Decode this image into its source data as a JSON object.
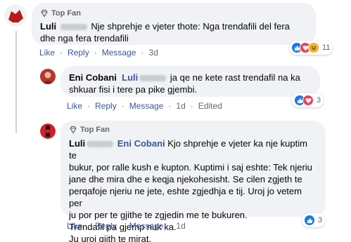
{
  "comments": [
    {
      "badge": "Top Fan",
      "author": "Luli",
      "author_hidden": "H…i",
      "text": "Nje shprehje e vjeter thote: Nga trendafili del fera dhe nga fera trendafili",
      "actions": {
        "like": "Like",
        "reply": "Reply",
        "message": "Message",
        "time": "3d"
      },
      "reactions": {
        "count": "11",
        "types": [
          "like-icon",
          "love-icon",
          "haha-icon"
        ]
      }
    },
    {
      "author": "Eni Cobani",
      "mention": "Luli",
      "text": "ja qe ne kete rast trendafil na ka shkuar fisi i tere pa pike gjembi.",
      "actions": {
        "like": "Like",
        "reply": "Reply",
        "message": "Message",
        "time": "1d",
        "edited": "Edited"
      },
      "reactions": {
        "count": "3",
        "types": [
          "like-icon",
          "love-icon"
        ]
      }
    },
    {
      "badge": "Top Fan",
      "author": "Luli",
      "mention": "Eni Cobani",
      "lines": [
        "Kjo shprehje e vjeter ka nje kuptim te",
        "bukur, por ralle kush e kupton. Kuptimi i saj eshte: Tek njeriu",
        "jane dhe mira dhe e keqja njekohesisht. Se cilen zgjeth te",
        "perqafoje njeriu ne jete, eshte zgjedhja e tij. Uroj jo vetem per",
        "ju por per te gjithe te zgjedin me te bukuren.",
        "Trendafil pa gjemp nuk ka.",
        "Ju uroj gjith te mirat."
      ],
      "actions": {
        "like": "Like",
        "reply": "Reply",
        "message": "Message",
        "time": "1d"
      },
      "reactions": {
        "count": "3",
        "types": [
          "like-icon"
        ]
      }
    }
  ],
  "colors": {
    "like": "#1877f2",
    "love": "#f33e58",
    "haha": "#f7b125",
    "link": "#385898",
    "bubble": "#f0f2f5"
  }
}
